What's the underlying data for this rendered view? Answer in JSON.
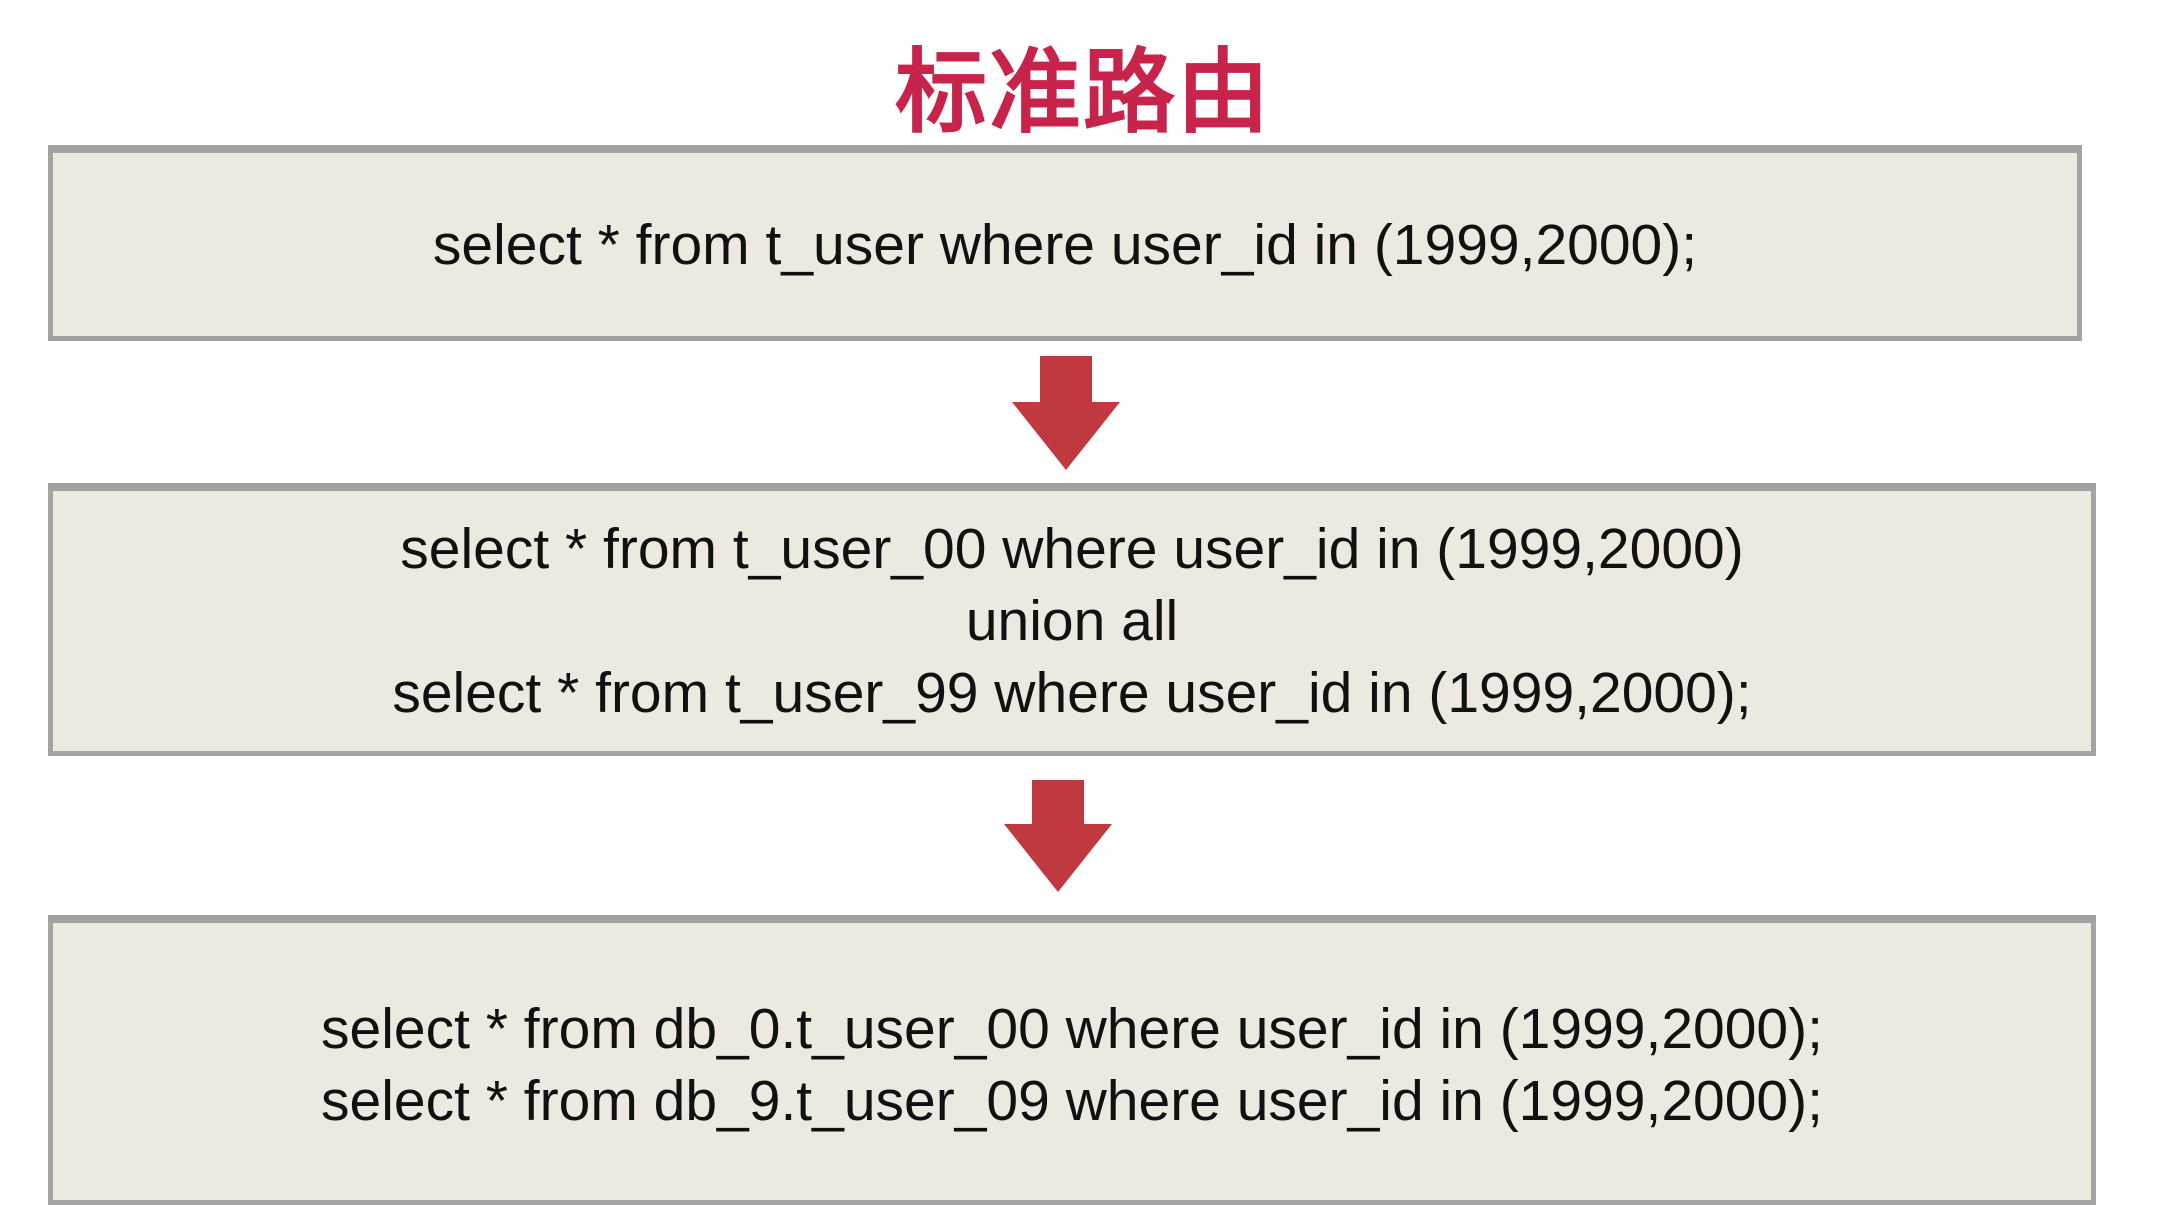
{
  "title": "标准路由",
  "steps": [
    {
      "lines": [
        "select * from t_user where user_id in (1999,2000);"
      ]
    },
    {
      "lines": [
        "select * from t_user_00 where user_id in (1999,2000)",
        "union all",
        "select * from t_user_99 where user_id in (1999,2000);"
      ]
    },
    {
      "lines": [
        "select * from db_0.t_user_00 where user_id in (1999,2000);",
        "select * from db_9.t_user_09 where user_id in (1999,2000);"
      ]
    }
  ],
  "colors": {
    "title": "#c8234a",
    "arrow": "#c0393f",
    "box": "#ebe9e0",
    "border": "#a3a3a3"
  }
}
